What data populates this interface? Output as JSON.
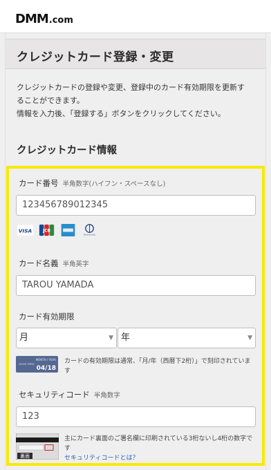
{
  "header": {
    "logo_main": "DMM",
    "logo_suffix": ".com"
  },
  "page": {
    "title": "クレジットカード登録・変更",
    "intro_line1": "クレジットカードの登録や変更、登録中のカード有効期限を更新することができます。",
    "intro_line2": "情報を入力後、「登録する」ボタンをクリックしてください。",
    "section_title": "クレジットカード情報"
  },
  "form": {
    "card_number": {
      "label": "カード番号",
      "hint": "半角数字(ハイフン・スペースなし)",
      "value": "123456789012345"
    },
    "card_brands": [
      "visa-icon",
      "jcb-icon",
      "amex-icon",
      "diners-icon"
    ],
    "brand_labels": {
      "visa": "VISA",
      "jcb": "JCB",
      "diners": "Diners Club"
    },
    "card_name": {
      "label": "カード名義",
      "hint": "半角英字",
      "value": "TAROU YAMADA"
    },
    "expiry": {
      "label": "カード有効期限",
      "month_selected": "月",
      "year_selected": "年",
      "card_caption": "MONTH / YEAR",
      "card_value": "04/18",
      "card_good_thru": "GOOD THRU",
      "note": "カードの有効期限は通常、「月/年（西暦下2桁）」で刻印されています"
    },
    "security": {
      "label": "セキュリティコード",
      "hint": "半角数字",
      "value": "123",
      "card_back_label": "裏面",
      "note": "主にカード裏面のご署名欄に印刷されている3桁ないし4桁の数字です",
      "link": "セキュリティコードとは？"
    }
  },
  "colors": {
    "highlight_border": "#f7ea00",
    "link": "#2d64b0",
    "background": "#efefef"
  }
}
